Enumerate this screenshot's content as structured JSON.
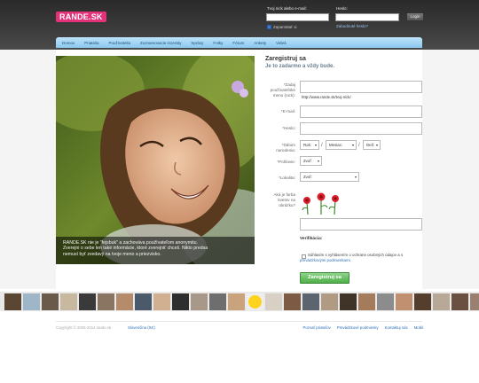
{
  "header": {
    "logo": "RANDE.SK",
    "login_nick_label": "Tvoj nick alebo e-mail:",
    "login_password_label": "Heslo:",
    "remember_label": "Zapamätať si",
    "forgot_password": "Zabudnuté heslo?",
    "login_button": "Login"
  },
  "nav": {
    "items": [
      {
        "label": "Domov"
      },
      {
        "label": "Priatelia"
      },
      {
        "label": "Používatelia"
      },
      {
        "label": "Zoznamovacie inzeráty"
      },
      {
        "label": "Správy"
      },
      {
        "label": "Fotky"
      },
      {
        "label": "Fórum"
      },
      {
        "label": "Ankety"
      },
      {
        "label": "Videá"
      }
    ]
  },
  "photo": {
    "caption_lines": [
      "RANDE.SK nie je \"fejsbuk\" a zachováva používateľom anonymitu.",
      "Zverejni o sebe len také informácie, ktoré zverejniť chceš. Nikto predsa",
      "nemusí byť zvedavý na tvoje meno a priezvisko."
    ]
  },
  "form": {
    "title": "Zaregistruj sa",
    "subtitle": "Je to zadarmo a vždy bude.",
    "nick_label_lines": [
      "*Zadaj",
      "používateľské",
      "meno (nick):"
    ],
    "nick_hint": "http://www.rande.sk/tvoj-nick/",
    "email_label": "*E-mail:",
    "password_label": "*Heslo:",
    "birthdate_label_lines": [
      "*Dátum",
      "narodenia:"
    ],
    "year_select": "Rok:",
    "month_select": "Mesiac:",
    "day_select": "Deň:",
    "gender_label": "*Pohlavie:",
    "gender_select": "Zvoľ:",
    "location_label": "*Lokalita:",
    "location_select": "Zvoľ:",
    "captcha_label_lines": [
      "Aká je farba",
      "kvetov na",
      "obrázku?"
    ],
    "verification_label": "Verifikácia:",
    "agree_text": "Súhlasím s vyhlásením o ochrane osobných údajov a s",
    "agree_link": "prevádzkovými podmienkami.",
    "submit": "Zaregistruj sa"
  },
  "footer": {
    "copyright": "Copyright © 2006-2014 rande.sk ·",
    "language": "Slovenčina (SK)",
    "links": [
      {
        "label": "Pozvať priateľov"
      },
      {
        "label": "Prevádzkové podmienky"
      },
      {
        "label": "Kontaktuj nás"
      },
      {
        "label": "Mobil"
      }
    ]
  },
  "colors": {
    "brand": "#e3317a",
    "nav": "#8cc8ef",
    "submit": "#4fae4a",
    "link": "#2a70b8"
  }
}
